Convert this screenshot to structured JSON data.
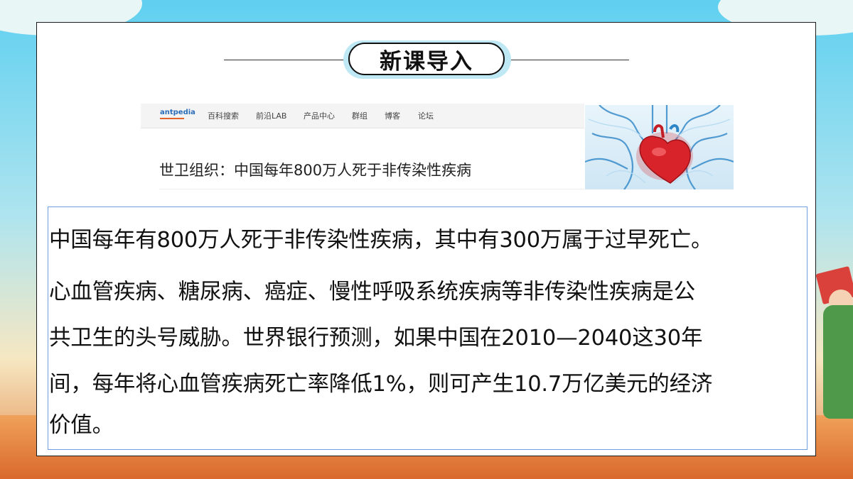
{
  "slide": {
    "section_title": "新课导入"
  },
  "web_snippet": {
    "logo_text": "antpedia",
    "nav_items": [
      "百科搜索",
      "前沿LAB",
      "产品中心",
      "群组",
      "博客",
      "论坛"
    ],
    "headline": "世卫组织：中国每年800万人死于非传染性疾病"
  },
  "body_text": {
    "line1": "中国每年有800万人死于非传染性疾病，其中有300万属于过早死亡。",
    "line2": "心血管疾病、糖尿病、癌症、慢性呼吸系统疾病等非传染性疾病是公",
    "line3": "共卫生的头号威胁。世界银行预测，如果中国在2010—2040这30年",
    "line4": "间，每年将心血管疾病死亡率降低1%，则可产生10.7万亿美元的经济",
    "line5": "价值。"
  },
  "colors": {
    "accent_blue": "#6f9fe0",
    "title_pill": "#bfe8f5",
    "heart_red": "#d8232a",
    "vessel_blue": "#2e86c8"
  }
}
